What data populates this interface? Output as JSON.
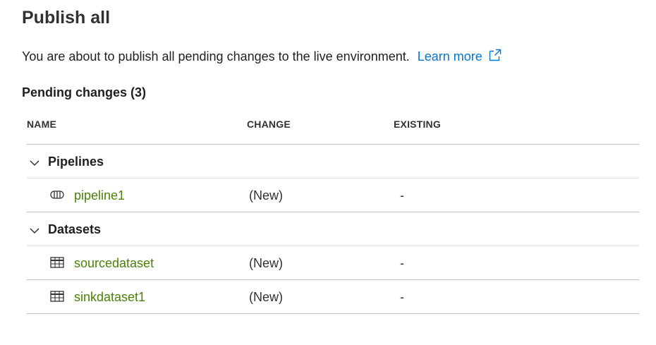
{
  "dialog": {
    "title": "Publish all",
    "description": "You are about to publish all pending changes to the live environment.",
    "learn_more": "Learn more"
  },
  "pending": {
    "label": "Pending changes",
    "count": "(3)"
  },
  "table": {
    "columns": [
      "NAME",
      "CHANGE",
      "EXISTING"
    ],
    "groups": [
      {
        "label": "Pipelines",
        "items": [
          {
            "name": "pipeline1",
            "change": "(New)",
            "existing": "-",
            "icon": "pipeline-icon"
          }
        ]
      },
      {
        "label": "Datasets",
        "items": [
          {
            "name": "sourcedataset",
            "change": "(New)",
            "existing": "-",
            "icon": "table-icon"
          },
          {
            "name": "sinkdataset1",
            "change": "(New)",
            "existing": "-",
            "icon": "table-icon"
          }
        ]
      }
    ]
  },
  "colors": {
    "link": "#0078d4",
    "item_name": "#498205",
    "text": "#201f1e",
    "divider": "#c8c6c4"
  }
}
